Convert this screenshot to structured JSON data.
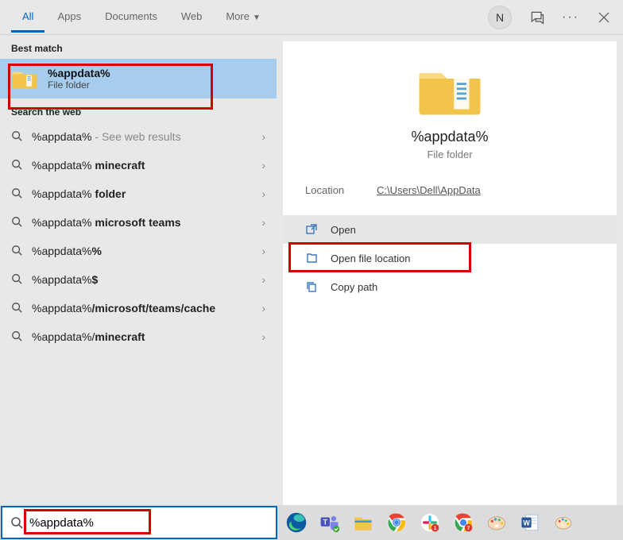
{
  "topbar": {
    "tabs": [
      "All",
      "Apps",
      "Documents",
      "Web",
      "More"
    ],
    "active_tab": 0,
    "avatar_initial": "N"
  },
  "left": {
    "best_match_header": "Best match",
    "best_match": {
      "title": "%appdata%",
      "subtitle": "File folder"
    },
    "web_header": "Search the web",
    "suggestions": [
      {
        "prefix": "%appdata%",
        "bold": "",
        "suffix": " - See web results",
        "muted_suffix": true
      },
      {
        "prefix": "%appdata%",
        "bold": " minecraft",
        "suffix": ""
      },
      {
        "prefix": "%appdata%",
        "bold": " folder",
        "suffix": ""
      },
      {
        "prefix": "%appdata%",
        "bold": " microsoft teams",
        "suffix": ""
      },
      {
        "prefix": "%appdata%",
        "bold": "%",
        "suffix": ""
      },
      {
        "prefix": "%appdata%",
        "bold": "$",
        "suffix": ""
      },
      {
        "prefix": "%appdata%",
        "bold": "/microsoft/teams/cache",
        "suffix": ""
      },
      {
        "prefix": "%appdata%/",
        "bold": "minecraft",
        "suffix": ""
      }
    ]
  },
  "preview": {
    "title": "%appdata%",
    "subtitle": "File folder",
    "location_label": "Location",
    "location_value": "C:\\Users\\Dell\\AppData",
    "actions": [
      {
        "label": "Open",
        "icon": "open"
      },
      {
        "label": "Open file location",
        "icon": "filelocation"
      },
      {
        "label": "Copy path",
        "icon": "copy"
      }
    ]
  },
  "searchbox": {
    "value": "%appdata%"
  }
}
